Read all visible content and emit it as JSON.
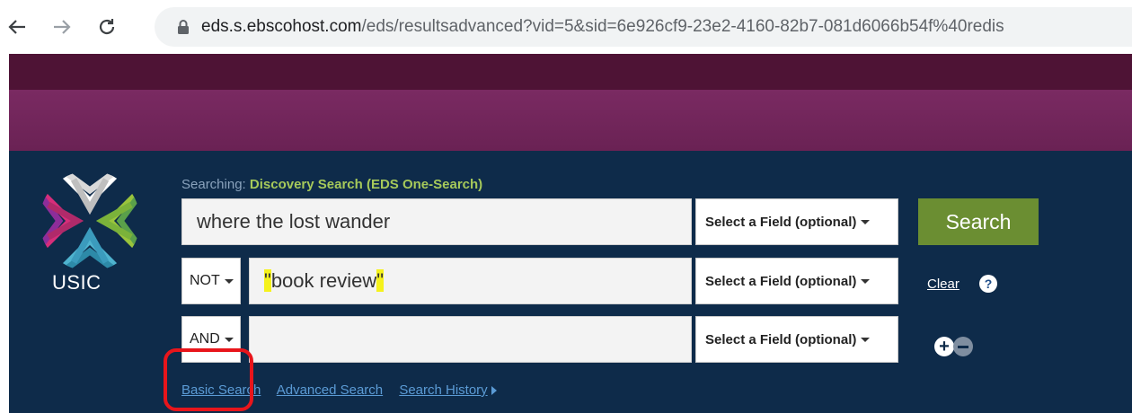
{
  "browser": {
    "url_host": "eds.s.ebscohost.com",
    "url_path": "/eds/resultsadvanced?vid=5&sid=6e926cf9-23e2-4160-82b7-081d6066b54f%40redis"
  },
  "logo": {
    "text": "USIC"
  },
  "searching": {
    "label": "Searching:",
    "database": "Discovery Search (EDS One-Search)"
  },
  "rows": [
    {
      "operator": "",
      "query": "where the lost wander",
      "field": "Select a Field (optional)"
    },
    {
      "operator": "NOT",
      "query_open_quote": "\"",
      "query_text": "book review",
      "query_close_quote": "\"",
      "field": "Select a Field (optional)"
    },
    {
      "operator": "AND",
      "query": "",
      "field": "Select a Field (optional)"
    }
  ],
  "buttons": {
    "search": "Search",
    "clear": "Clear",
    "help": "?",
    "add": "+"
  },
  "links": {
    "basic": "Basic Search",
    "advanced": "Advanced Search",
    "history": "Search History"
  },
  "colors": {
    "search_button": "#6b8e32",
    "panel": "#0e2b4a",
    "band_dark": "#4e1335",
    "highlight": "#f5f21c",
    "annotation": "#e8151b"
  }
}
